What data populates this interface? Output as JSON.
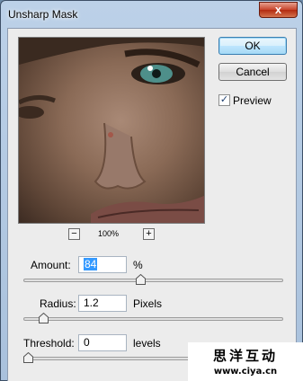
{
  "window": {
    "title": "Unsharp Mask",
    "close_glyph": "x"
  },
  "buttons": {
    "ok": "OK",
    "cancel": "Cancel"
  },
  "preview_toggle": {
    "label": "Preview",
    "checked": true,
    "glyph": "✓"
  },
  "zoom": {
    "level": "100%",
    "minus": "−",
    "plus": "+"
  },
  "amount": {
    "label": "Amount:",
    "value": "84",
    "unit": "%",
    "slider_fraction": 0.45
  },
  "radius": {
    "label": "Radius:",
    "value": "1.2",
    "unit": "Pixels",
    "slider_fraction": 0.06
  },
  "threshold": {
    "label": "Threshold:",
    "value": "0",
    "unit": "levels",
    "slider_fraction": 0.0
  },
  "watermark": {
    "chinese": "思洋互动",
    "url": "www.ciya.cn"
  },
  "colors": {
    "titlebar": "#bcd1e8",
    "client": "#ececec",
    "selection": "#3399ff",
    "close": "#c7432a"
  }
}
